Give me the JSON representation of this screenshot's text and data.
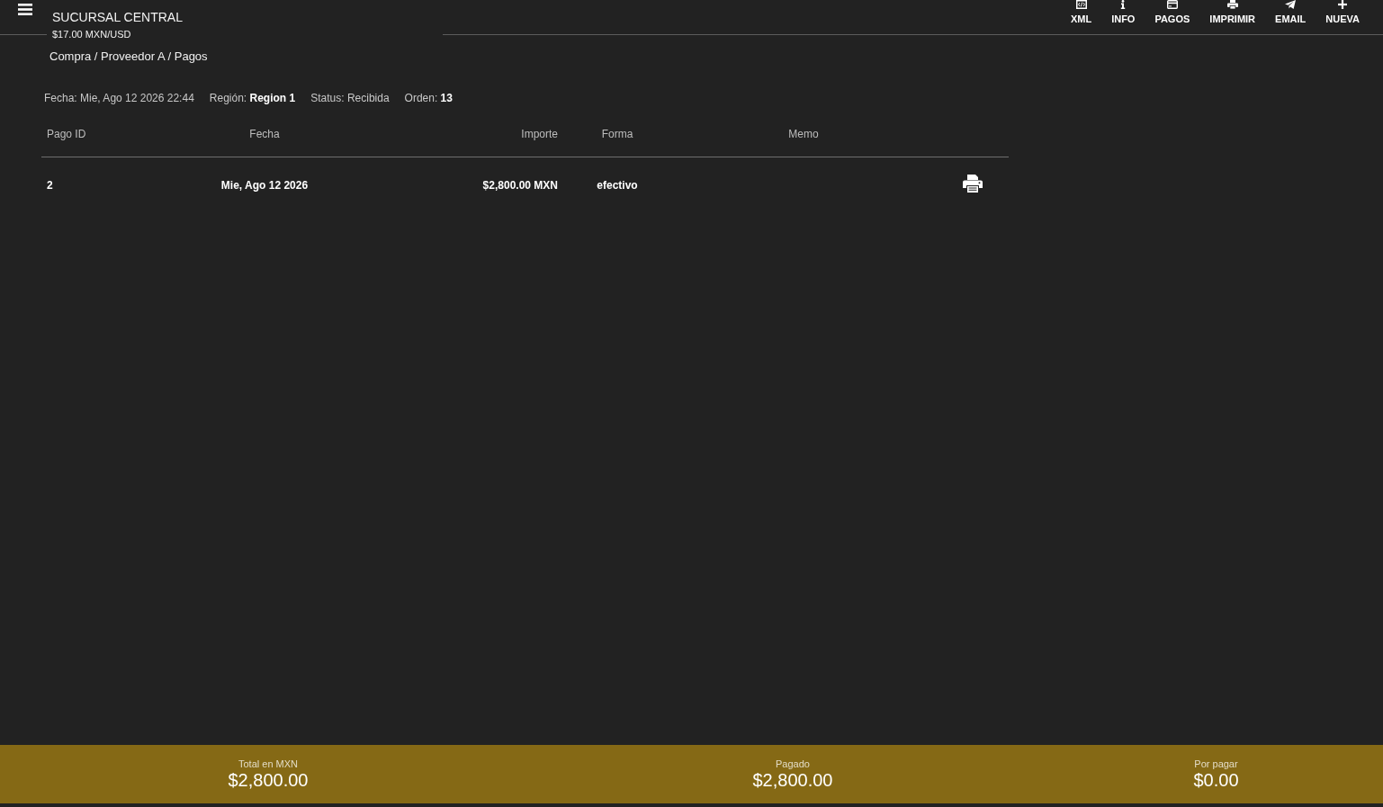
{
  "header": {
    "title": "SUCURSAL CENTRAL",
    "exchange_rate": "$17.00 MXN/USD"
  },
  "actions": [
    {
      "label": "XML",
      "kind": "xml"
    },
    {
      "label": "INFO",
      "kind": "info"
    },
    {
      "label": "PAGOS",
      "kind": "payments"
    },
    {
      "label": "IMPRIMIR",
      "kind": "print"
    },
    {
      "label": "EMAIL",
      "kind": "email"
    },
    {
      "label": "NUEVA",
      "kind": "new"
    }
  ],
  "breadcrumb": "Compra / Proveedor A / Pagos",
  "summary": [
    {
      "label": "Fecha:",
      "value": "Mie, Ago 12 2026 22:44",
      "emphasized": false
    },
    {
      "label": "Región:",
      "value": "Region 1",
      "emphasized": true
    },
    {
      "label": "Status:",
      "value": "Recibida",
      "emphasized": false
    },
    {
      "label": "Orden:",
      "value": "13",
      "emphasized": true
    }
  ],
  "table": {
    "columns": [
      "Pago ID",
      "Fecha",
      "Importe",
      "Forma",
      "Memo"
    ],
    "rows": [
      {
        "cells": [
          "2",
          "Mie, Ago 12 2026",
          "$2,800.00 MXN",
          "efectivo"
        ]
      }
    ]
  },
  "totals": [
    {
      "label": "Total en MXN",
      "value": "$2,800.00"
    },
    {
      "label": "Pagado",
      "value": "$2,800.00"
    },
    {
      "label": "Por pagar",
      "value": "$0.00"
    }
  ]
}
